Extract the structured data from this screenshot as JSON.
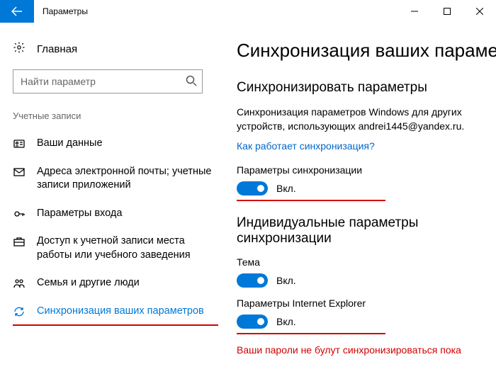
{
  "window": {
    "title": "Параметры"
  },
  "sidebar": {
    "home": "Главная",
    "search_placeholder": "Найти параметр",
    "section": "Учетные записи",
    "items": [
      {
        "label": "Ваши данные"
      },
      {
        "label": "Адреса электронной почты; учетные записи приложений"
      },
      {
        "label": "Параметры входа"
      },
      {
        "label": "Доступ к учетной записи места работы или учебного заведения"
      },
      {
        "label": "Семья и другие люди"
      },
      {
        "label": "Синхронизация ваших параметров"
      }
    ]
  },
  "main": {
    "heading": "Синхронизация ваших параме",
    "section1_title": "Синхронизировать параметры",
    "desc": "Синхронизация параметров Windows для других устройств, использующих andrei1445@yandex.ru.",
    "link": "Как работает синхронизация?",
    "master_label": "Параметры синхронизации",
    "on_label": "Вкл.",
    "section2_title": "Индивидуальные параметры синхронизации",
    "theme_label": "Тема",
    "ie_label": "Параметры Internet Explorer",
    "warning": "Ваши пароли не булут синхронизироваться пока"
  }
}
